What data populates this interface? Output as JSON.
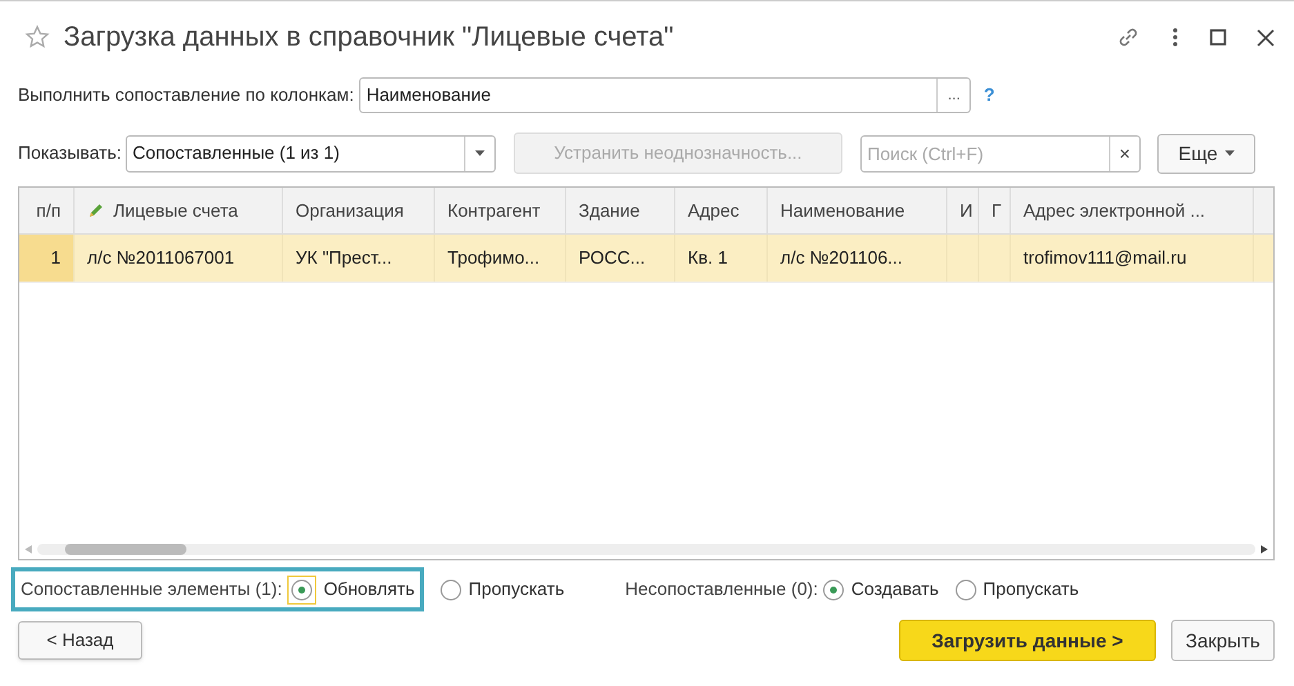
{
  "window": {
    "title": "Загрузка данных в справочник \"Лицевые счета\""
  },
  "mapping": {
    "label": "Выполнить сопоставление по колонкам:",
    "value": "Наименование",
    "select_button": "...",
    "help": "?"
  },
  "toolbar": {
    "show_label": "Показывать:",
    "show_value": "Сопоставленные (1 из 1)",
    "resolve_button": {
      "label": "Устранить неоднозначность...",
      "disabled": true
    },
    "search": {
      "placeholder": "Поиск (Ctrl+F)"
    },
    "clear": "×",
    "more_button": "Еще"
  },
  "table": {
    "columns": [
      {
        "label": "п/п",
        "kind": "number"
      },
      {
        "label": "Лицевые счета",
        "kind": "editable"
      },
      {
        "label": "Организация",
        "kind": "text"
      },
      {
        "label": "Контрагент",
        "kind": "text"
      },
      {
        "label": "Здание",
        "kind": "text"
      },
      {
        "label": "Адрес",
        "kind": "text"
      },
      {
        "label": "Наименование",
        "kind": "text"
      },
      {
        "label": "И",
        "kind": "text"
      },
      {
        "label": "Г",
        "kind": "text"
      },
      {
        "label": "Адрес электронной ...",
        "kind": "text"
      }
    ],
    "rows": [
      {
        "selected": true,
        "cells": [
          "1",
          "л/с №2011067001",
          "УК \"Прест...",
          "Трофимо...",
          "РОСС...",
          "Кв. 1",
          "л/с №201106...",
          "",
          "",
          "trofimov111@mail.ru"
        ]
      }
    ]
  },
  "matched": {
    "label": "Сопоставленные элементы (1):",
    "options": [
      {
        "label": "Обновлять",
        "selected": true
      },
      {
        "label": "Пропускать",
        "selected": false
      }
    ]
  },
  "unmatched": {
    "label": "Несопоставленные (0):",
    "options": [
      {
        "label": "Создавать",
        "selected": true
      },
      {
        "label": "Пропускать",
        "selected": false
      }
    ]
  },
  "buttons": {
    "back": "< Назад",
    "load": "Загрузить данные >",
    "close": "Закрыть"
  }
}
